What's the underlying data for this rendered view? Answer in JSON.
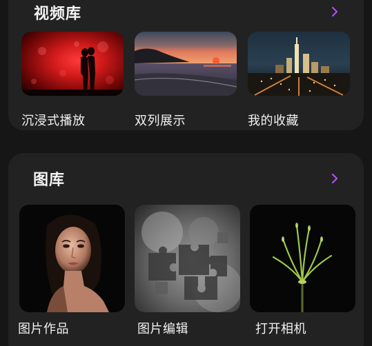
{
  "video_section": {
    "title": "视频库",
    "more_icon": "chevron-right-icon",
    "items": [
      {
        "label": "沉浸式播放",
        "image": "couple-silhouette-red"
      },
      {
        "label": "双列展示",
        "image": "beach-sunset"
      },
      {
        "label": "我的收藏",
        "image": "city-night"
      }
    ]
  },
  "gallery_section": {
    "title": "图库",
    "more_icon": "chevron-right-icon",
    "items": [
      {
        "label": "图片作品",
        "image": "woman-portrait"
      },
      {
        "label": "图片编辑",
        "image": "gray-smoke-puzzle"
      },
      {
        "label": "打开相机",
        "image": "green-plant-dark"
      }
    ]
  },
  "colors": {
    "background": "#161616",
    "card": "#222222",
    "accent": "#b14df5",
    "text": "#f2f2f2"
  }
}
